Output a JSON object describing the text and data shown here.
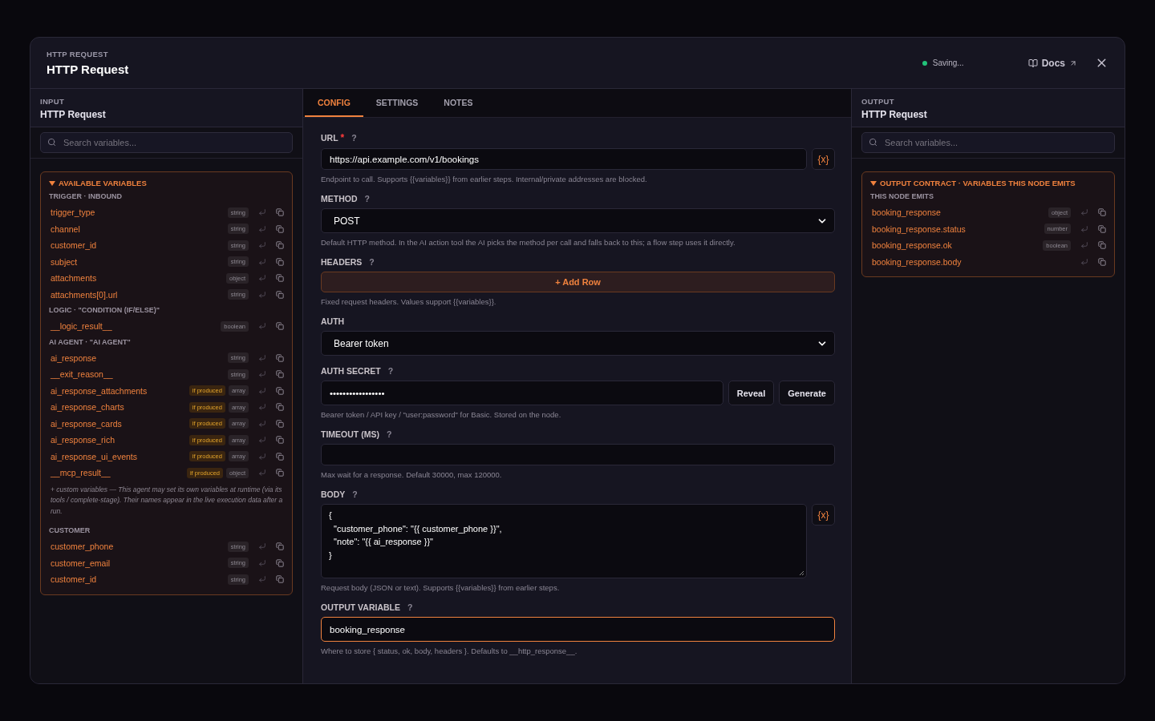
{
  "header": {
    "eyebrow": "HTTP REQUEST",
    "title": "HTTP Request",
    "status": "Saving...",
    "docs": "Docs"
  },
  "input_panel": {
    "eyebrow": "INPUT",
    "title": "HTTP Request",
    "search": {
      "placeholder": "Search variables..."
    },
    "card": {
      "title": "AVAILABLE VARIABLES",
      "expanded": true,
      "sections": [
        {
          "title": "TRIGGER · INBOUND",
          "items": [
            {
              "name": "trigger_type",
              "type": "string"
            },
            {
              "name": "channel",
              "type": "string"
            },
            {
              "name": "customer_id",
              "type": "string"
            },
            {
              "name": "subject",
              "type": "string"
            },
            {
              "name": "attachments",
              "type": "object"
            },
            {
              "name": "attachments[0].url",
              "type": "string"
            }
          ]
        },
        {
          "title": "LOGIC · \"CONDITION (IF/ELSE)\"",
          "items": [
            {
              "name": "__logic_result__",
              "type": "boolean"
            }
          ]
        },
        {
          "title": "AI AGENT · \"AI AGENT\"",
          "items": [
            {
              "name": "ai_response",
              "type": "string"
            },
            {
              "name": "__exit_reason__",
              "type": "string"
            },
            {
              "name": "ai_response_attachments",
              "badge": "if produced",
              "type": "array"
            },
            {
              "name": "ai_response_charts",
              "badge": "if produced",
              "type": "array"
            },
            {
              "name": "ai_response_cards",
              "badge": "if produced",
              "type": "array"
            },
            {
              "name": "ai_response_rich",
              "badge": "if produced",
              "type": "array"
            },
            {
              "name": "ai_response_ui_events",
              "badge": "if produced",
              "type": "array"
            },
            {
              "name": "__mcp_result__",
              "badge": "if produced",
              "type": "object"
            }
          ],
          "note": "+ custom variables — This agent may set its own variables at runtime (via its tools / complete-stage). Their names appear in the live execution data after a run."
        },
        {
          "title": "CUSTOMER",
          "items": [
            {
              "name": "customer_phone",
              "type": "string"
            },
            {
              "name": "customer_email",
              "type": "string"
            },
            {
              "name": "customer_id",
              "type": "string"
            }
          ]
        }
      ]
    }
  },
  "tabs": [
    {
      "label": "CONFIG",
      "selected": true
    },
    {
      "label": "SETTINGS",
      "selected": false
    },
    {
      "label": "NOTES",
      "selected": false
    }
  ],
  "fields": [
    {
      "kind": "text",
      "label": "URL",
      "required_mark": "*",
      "help": "?",
      "value": "https://api.example.com/v1/bookings",
      "var_button": "{x}",
      "hint": "Endpoint to call. Supports {{variables}} from earlier steps. Internal/private addresses are blocked."
    },
    {
      "kind": "select",
      "label": "METHOD",
      "help": "?",
      "value": "POST",
      "hint": "Default HTTP method. In the AI action tool the AI picks the method per call and falls back to this; a flow step uses it directly."
    },
    {
      "kind": "rows",
      "label": "HEADERS",
      "help": "?",
      "button": "+ Add Row",
      "hint": "Fixed request headers. Values support {{variables}}."
    },
    {
      "kind": "select",
      "label": "AUTH",
      "value": "Bearer token"
    },
    {
      "kind": "secret",
      "label": "AUTH SECRET",
      "help": "?",
      "value": "•••••••••••••••••",
      "buttons": [
        "Reveal",
        "Generate"
      ],
      "hint": "Bearer token / API key / \"user:password\" for Basic. Stored on the node."
    },
    {
      "kind": "text",
      "label": "TIMEOUT (MS)",
      "help": "?",
      "hint": "Max wait for a response. Default 30000, max 120000."
    },
    {
      "kind": "textarea",
      "label": "BODY",
      "help": "?",
      "value": "{\n  \"customer_phone\": \"{{ customer_phone }}\",\n  \"note\": \"{{ ai_response }}\"\n}",
      "var_button": "{x}",
      "hint": "Request body (JSON or text). Supports {{variables}} from earlier steps."
    },
    {
      "kind": "text",
      "label": "OUTPUT VARIABLE",
      "help": "?",
      "value": "booking_response",
      "focused": true,
      "hint": "Where to store { status, ok, body, headers }. Defaults to __http_response__."
    }
  ],
  "output_panel": {
    "eyebrow": "OUTPUT",
    "title": "HTTP Request",
    "search": {
      "placeholder": "Search variables..."
    },
    "card": {
      "title": "OUTPUT CONTRACT · VARIABLES THIS NODE EMITS",
      "expanded": true,
      "sections": [
        {
          "title": "THIS NODE EMITS",
          "items": [
            {
              "name": "booking_response",
              "type": "object"
            },
            {
              "name": "booking_response.status",
              "type": "number"
            },
            {
              "name": "booking_response.ok",
              "type": "boolean"
            },
            {
              "name": "booking_response.body"
            }
          ]
        }
      ]
    }
  }
}
